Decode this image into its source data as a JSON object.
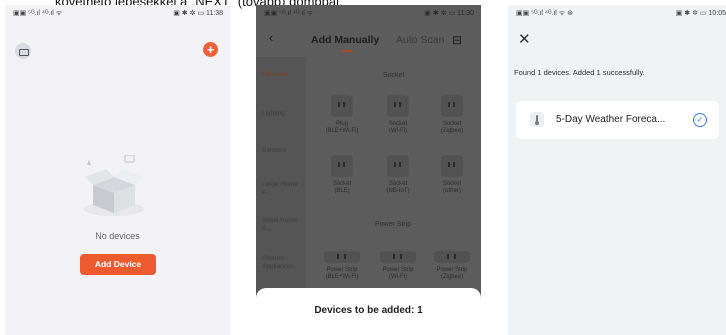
{
  "caption": "követhető lépésekkel a „NEXT” (tovább) gombbal.",
  "screen1": {
    "status_left": "▣▣ ⁵ᴳ.ıl ⁴ᴳ.ıl ᯤ",
    "status_right": "▣ ✱ ✲ ▭ 11:38",
    "add_icon": "+",
    "empty_text": "No devices",
    "add_device_label": "Add Device"
  },
  "screen2": {
    "status_left": "▣▣ ⁵ᴳ.ıl ⁴ᴳ.ıl ᯤ",
    "status_right": "▣ ✱ ✲ ▭ 11:30",
    "back_icon": "‹",
    "tab_manual": "Add Manually",
    "tab_auto": "Auto Scan",
    "scan_icon": "⊟",
    "categories": [
      "Electrical",
      "Lighting",
      "Sensors",
      "Large Home A...",
      "Small Home A...",
      "Kitchen Appliances"
    ],
    "section_socket": "Socket",
    "socket_devices": [
      {
        "line1": "Plug",
        "line2": "(BLE+Wi-Fi)"
      },
      {
        "line1": "Socket",
        "line2": "(Wi-Fi)"
      },
      {
        "line1": "Socket",
        "line2": "(Zigbee)"
      },
      {
        "line1": "Socket",
        "line2": "(BLE)"
      },
      {
        "line1": "Socket",
        "line2": "(NB-IoT)"
      },
      {
        "line1": "Socket",
        "line2": "(other)"
      }
    ],
    "section_strip": "Power Strip",
    "strip_devices": [
      {
        "line1": "Power Strip",
        "line2": "(BLE+Wi-Fi)"
      },
      {
        "line1": "Power Strip",
        "line2": "(Wi-Fi)"
      },
      {
        "line1": "Power Strip",
        "line2": "(Zigbee)"
      }
    ],
    "sheet_text": "Devices to be added: 1"
  },
  "screen3": {
    "status_left": "▣▣ ⁵ᴳ.ıl ⁴ᴳ.ıl ᯤ ⊛",
    "status_right": "▣ ✱ ✲ ▭ 10:05",
    "close_icon": "✕",
    "found_text": "Found 1 devices. Added 1 successfully.",
    "device_icon": "🌡",
    "device_name": "5-Day Weather Foreca...",
    "check_icon": "✓"
  },
  "colors": {
    "accent": "#ec5a2e",
    "tab_accent": "#a54a2c",
    "check_blue": "#3d7ef2",
    "overlay_bg": "#5c5c5c"
  }
}
